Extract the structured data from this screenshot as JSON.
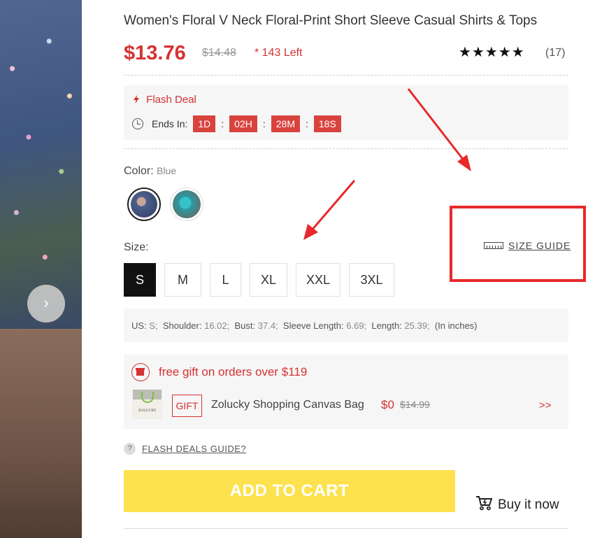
{
  "product": {
    "title": "Women's Floral V Neck Floral-Print Short Sleeve Casual Shirts & Tops",
    "price": "$13.76",
    "old_price": "$14.48",
    "stock_left": "* 143 Left",
    "rating_stars": "★★★★★",
    "rating": 5,
    "review_count": "(17)"
  },
  "flash_deal": {
    "label": "Flash Deal",
    "ends_in_label": "Ends In:",
    "days": "1D",
    "hours": "02H",
    "minutes": "28M",
    "seconds": "18S",
    "separator": ":"
  },
  "color": {
    "label": "Color:",
    "selected": "Blue",
    "options": [
      "blue-floral",
      "teal-floral"
    ]
  },
  "size": {
    "label": "Size:",
    "guide_label": "SIZE GUIDE",
    "options": [
      "S",
      "M",
      "L",
      "XL",
      "XXL",
      "3XL"
    ],
    "selected": "S"
  },
  "measurements": {
    "us_label": "US:",
    "us_value": "S;",
    "shoulder_label": "Shoulder:",
    "shoulder_value": "16.02;",
    "bust_label": "Bust:",
    "bust_value": "37.4;",
    "sleeve_label": "Sleeve Length:",
    "sleeve_value": "6.69;",
    "length_label": "Length:",
    "length_value": "25.39;",
    "unit_note": "(In inches)"
  },
  "gift": {
    "title": "free gift on orders over $119",
    "tag": "GIFT",
    "name": "Zolucky Shopping Canvas Bag",
    "price": "$0",
    "old_price": "$14.99",
    "more": ">>",
    "thumb_brand": "ZOLUCKY"
  },
  "guide_link": "FLASH DEALS GUIDE?",
  "guide_icon": "?",
  "actions": {
    "add_to_cart": "ADD TO CART",
    "buy_now": "Buy it now"
  },
  "gallery": {
    "next_icon": "›"
  },
  "colors": {
    "accent_red": "#d53232",
    "cart_yellow": "#fde14e",
    "annotation_red": "#e8292b"
  }
}
